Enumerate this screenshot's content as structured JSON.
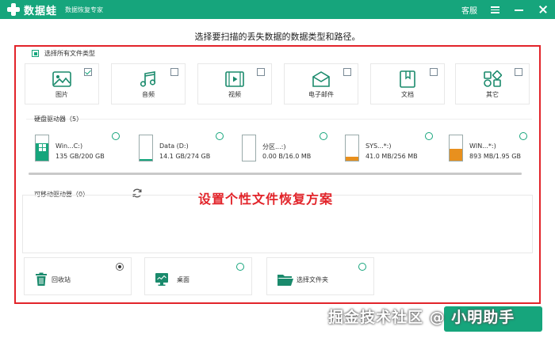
{
  "app": {
    "name": "数据蛙",
    "subtitle": "数据恢复专家",
    "support_label": "客服"
  },
  "instruction": "选择要扫描的丢失数据的数据类型和路径。",
  "select_all_label": "选择所有文件类型",
  "file_types": [
    {
      "label": "图片",
      "icon": "image-icon",
      "checked": true
    },
    {
      "label": "音频",
      "icon": "music-icon",
      "checked": false
    },
    {
      "label": "视频",
      "icon": "video-icon",
      "checked": false
    },
    {
      "label": "电子邮件",
      "icon": "mail-icon",
      "checked": false
    },
    {
      "label": "文档",
      "icon": "document-icon",
      "checked": false
    },
    {
      "label": "其它",
      "icon": "other-icon",
      "checked": false
    }
  ],
  "hard_drives": {
    "label": "硬盘驱动器（5）",
    "items": [
      {
        "name": "Win...C:)",
        "size": "135 GB/200 GB",
        "fill": 0.675,
        "color": "#16a57c",
        "windows": true
      },
      {
        "name": "Data (D:)",
        "size": "14.1 GB/274 GB",
        "fill": 0.05,
        "color": "#16a57c",
        "windows": false
      },
      {
        "name": "分区...:)",
        "size": "0.00  B/16.0 MB",
        "fill": 0.0,
        "color": "#e8901e",
        "windows": false
      },
      {
        "name": "SYS...*:)",
        "size": "41.0 MB/256 MB",
        "fill": 0.16,
        "color": "#e8901e",
        "windows": false
      },
      {
        "name": "WIN...*:)",
        "size": "893 MB/1.95 GB",
        "fill": 0.46,
        "color": "#e8901e",
        "windows": false
      }
    ]
  },
  "removable_drives": {
    "label": "可移动驱动器（0）"
  },
  "overlay_annotation": "设置个性文件恢复方案",
  "locations": [
    {
      "label": "回收站",
      "icon": "trash-icon",
      "selected": true
    },
    {
      "label": "桌面",
      "icon": "desktop-icon",
      "selected": false
    },
    {
      "label": "选择文件夹",
      "icon": "folder-icon",
      "selected": false
    }
  ],
  "watermark": "掘金技术社区 @ 小明助手",
  "colors": {
    "accent": "#16a57c",
    "highlight": "#e2242a",
    "warning": "#e8901e"
  }
}
